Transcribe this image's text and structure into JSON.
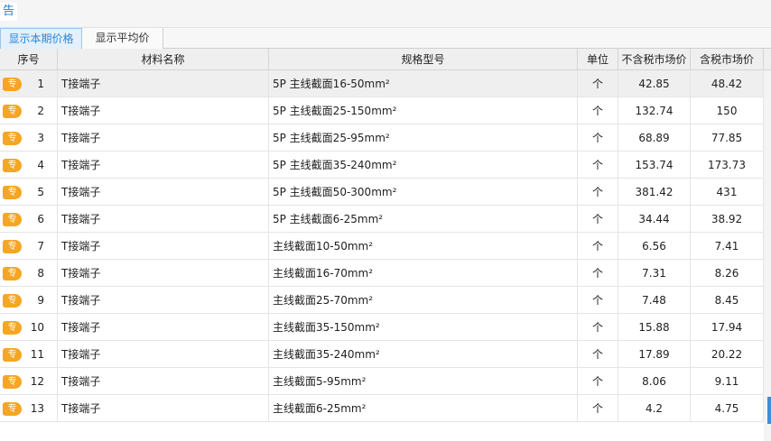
{
  "window": {
    "title": "告"
  },
  "tabs": [
    {
      "label": "显示本期价格",
      "active": true
    },
    {
      "label": "显示平均价",
      "active": false
    }
  ],
  "table": {
    "columns": [
      "序号",
      "材料名称",
      "规格型号",
      "单位",
      "不含税市场价",
      "含税市场价"
    ],
    "badge_label": "专",
    "rows": [
      {
        "seq": "1",
        "name": "T接端子",
        "spec": "5P 主线截面16-50mm²",
        "unit": "个",
        "price_ex": "42.85",
        "price_inc": "48.42"
      },
      {
        "seq": "2",
        "name": "T接端子",
        "spec": "5P 主线截面25-150mm²",
        "unit": "个",
        "price_ex": "132.74",
        "price_inc": "150"
      },
      {
        "seq": "3",
        "name": "T接端子",
        "spec": "5P 主线截面25-95mm²",
        "unit": "个",
        "price_ex": "68.89",
        "price_inc": "77.85"
      },
      {
        "seq": "4",
        "name": "T接端子",
        "spec": "5P 主线截面35-240mm²",
        "unit": "个",
        "price_ex": "153.74",
        "price_inc": "173.73"
      },
      {
        "seq": "5",
        "name": "T接端子",
        "spec": "5P 主线截面50-300mm²",
        "unit": "个",
        "price_ex": "381.42",
        "price_inc": "431"
      },
      {
        "seq": "6",
        "name": "T接端子",
        "spec": "5P 主线截面6-25mm²",
        "unit": "个",
        "price_ex": "34.44",
        "price_inc": "38.92"
      },
      {
        "seq": "7",
        "name": "T接端子",
        "spec": "主线截面10-50mm²",
        "unit": "个",
        "price_ex": "6.56",
        "price_inc": "7.41"
      },
      {
        "seq": "8",
        "name": "T接端子",
        "spec": "主线截面16-70mm²",
        "unit": "个",
        "price_ex": "7.31",
        "price_inc": "8.26"
      },
      {
        "seq": "9",
        "name": "T接端子",
        "spec": "主线截面25-70mm²",
        "unit": "个",
        "price_ex": "7.48",
        "price_inc": "8.45"
      },
      {
        "seq": "10",
        "name": "T接端子",
        "spec": "主线截面35-150mm²",
        "unit": "个",
        "price_ex": "15.88",
        "price_inc": "17.94"
      },
      {
        "seq": "11",
        "name": "T接端子",
        "spec": "主线截面35-240mm²",
        "unit": "个",
        "price_ex": "17.89",
        "price_inc": "20.22"
      },
      {
        "seq": "12",
        "name": "T接端子",
        "spec": "主线截面5-95mm²",
        "unit": "个",
        "price_ex": "8.06",
        "price_inc": "9.11"
      },
      {
        "seq": "13",
        "name": "T接端子",
        "spec": "主线截面6-25mm²",
        "unit": "个",
        "price_ex": "4.2",
        "price_inc": "4.75"
      }
    ],
    "selected_row": 0
  },
  "colors": {
    "accent": "#2a87d8",
    "badge": "#f5a623",
    "scroll_thumb": "#3b8fdc"
  }
}
